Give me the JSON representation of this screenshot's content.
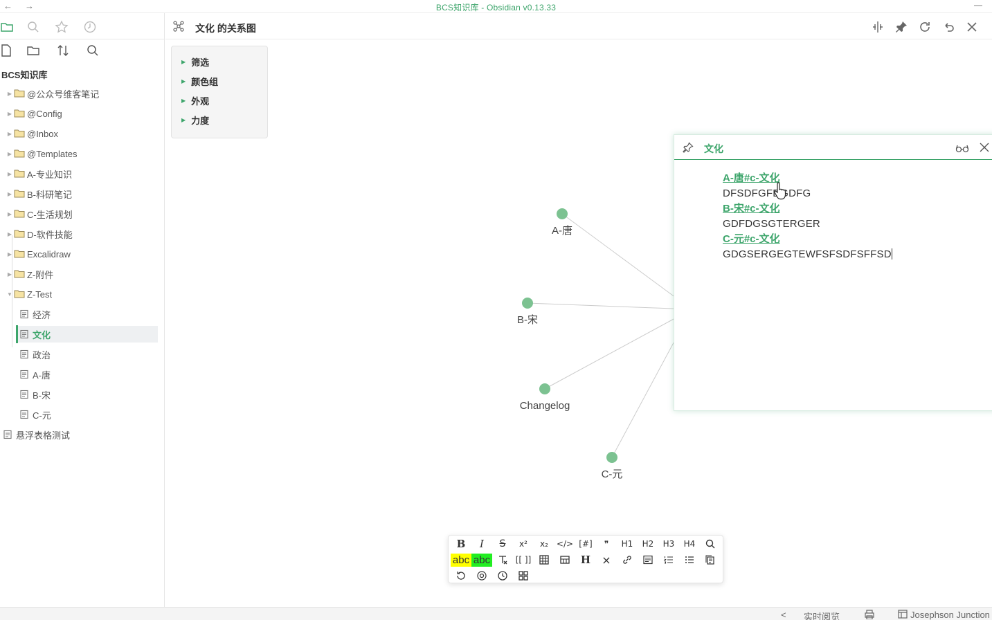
{
  "window": {
    "title": "BCS知识库 - Obsidian v0.13.33",
    "back": "←",
    "forward": "→",
    "minimize": "—"
  },
  "sidebar": {
    "vault_name": "BCS知识库",
    "tree": [
      {
        "label": "@公众号维客笔记",
        "type": "folder",
        "expanded": false
      },
      {
        "label": "@Config",
        "type": "folder",
        "expanded": false
      },
      {
        "label": "@Inbox",
        "type": "folder",
        "expanded": false
      },
      {
        "label": "@Templates",
        "type": "folder",
        "expanded": false
      },
      {
        "label": "A-专业知识",
        "type": "folder",
        "expanded": false
      },
      {
        "label": "B-科研笔记",
        "type": "folder",
        "expanded": false
      },
      {
        "label": "C-生活规划",
        "type": "folder",
        "expanded": false
      },
      {
        "label": "D-软件技能",
        "type": "folder",
        "expanded": false
      },
      {
        "label": "Excalidraw",
        "type": "folder",
        "expanded": false
      },
      {
        "label": "Z-附件",
        "type": "folder",
        "expanded": false
      },
      {
        "label": "Z-Test",
        "type": "folder",
        "expanded": true
      },
      {
        "label": "经济",
        "type": "file"
      },
      {
        "label": "文化",
        "type": "file",
        "active": true
      },
      {
        "label": "政治",
        "type": "file"
      },
      {
        "label": "A-唐",
        "type": "file"
      },
      {
        "label": "B-宋",
        "type": "file"
      },
      {
        "label": "C-元",
        "type": "file"
      },
      {
        "label": "悬浮表格测试",
        "type": "file"
      }
    ]
  },
  "main": {
    "view_title": "文化 的关系图"
  },
  "graph_controls": {
    "items": [
      "筛选",
      "颜色组",
      "外观",
      "力度"
    ]
  },
  "graph": {
    "node_color": "#7cc291",
    "edge_color": "#cccccc",
    "nodes": [
      {
        "label": "A-唐"
      },
      {
        "label": "B-宋"
      },
      {
        "label": "Changelog"
      },
      {
        "label": "C-元"
      }
    ]
  },
  "popover": {
    "title": "文化",
    "lines": [
      {
        "kind": "link",
        "text": "A-唐#c-文化"
      },
      {
        "kind": "text",
        "text": "DFSDFGFDGDFG"
      },
      {
        "kind": "link",
        "text": "B-宋#c-文化"
      },
      {
        "kind": "text",
        "text": "GDFDGSGTERGER"
      },
      {
        "kind": "link",
        "text": "C-元#c-文化"
      },
      {
        "kind": "text",
        "text": "GDGSERGEGTEWFSFSDFSFFSD"
      }
    ]
  },
  "toolbar": {
    "row1": [
      "B",
      "I",
      "S",
      "x²",
      "x₂",
      "</>",
      "[#]",
      "❞",
      "H1",
      "H2",
      "H3",
      "H4",
      "search"
    ],
    "highlight_yellow": "abc",
    "highlight_green": "abc",
    "row2": [
      "clear",
      "[[ ]]",
      "table",
      "cols",
      "H",
      "×",
      "link",
      "doc",
      "ol",
      "ul",
      "copy"
    ],
    "row3": [
      "undo",
      "at",
      "clock",
      "grid"
    ],
    "yellow": "#ffff00",
    "green": "#22ee22"
  },
  "statusbar": {
    "chevron": "<",
    "mode": "实时阅览",
    "theme": "Josephson Junction"
  }
}
